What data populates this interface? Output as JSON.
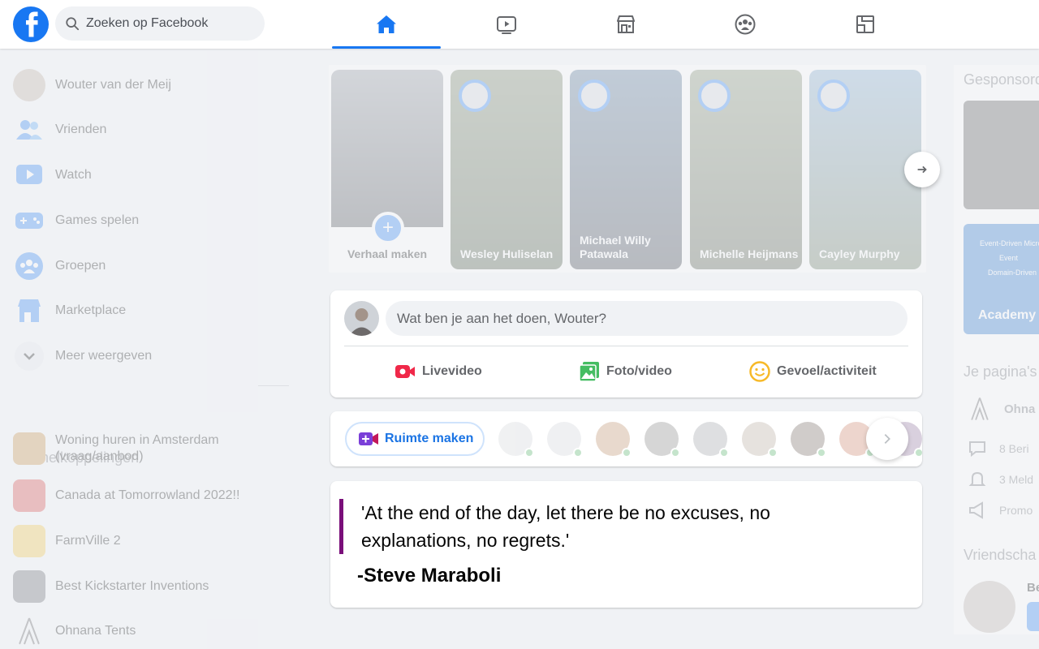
{
  "search": {
    "placeholder": "Zoeken op Facebook"
  },
  "nav": {
    "tabs": [
      {
        "name": "home-icon",
        "active": true
      },
      {
        "name": "watch-icon",
        "active": false
      },
      {
        "name": "marketplace-icon",
        "active": false
      },
      {
        "name": "groups-icon",
        "active": false
      },
      {
        "name": "gaming-icon",
        "active": false
      }
    ]
  },
  "sidebar": {
    "items": [
      {
        "label": "Wouter van der Meij",
        "icon": "avatar"
      },
      {
        "label": "Vrienden",
        "icon": "friends-icon"
      },
      {
        "label": "Watch",
        "icon": "watch-icon"
      },
      {
        "label": "Games spelen",
        "icon": "games-icon"
      },
      {
        "label": "Groepen",
        "icon": "groups-icon"
      },
      {
        "label": "Marketplace",
        "icon": "marketplace-icon"
      },
      {
        "label": "Meer weergeven",
        "icon": "chevron-down-icon"
      }
    ],
    "shortcuts_heading": "Je snelkoppelingen",
    "shortcuts": [
      {
        "label": "Woning huren in Amsterdam (vraag/aanbod)"
      },
      {
        "label": "Canada at Tomorrowland 2022!!"
      },
      {
        "label": "FarmVille 2"
      },
      {
        "label": "Best Kickstarter Inventions"
      },
      {
        "label": "Ohnana Tents"
      }
    ]
  },
  "stories": {
    "create_label": "Verhaal maken",
    "items": [
      {
        "name": "Wesley Huliselan"
      },
      {
        "name": "Michael Willy Patawala"
      },
      {
        "name": "Michelle Heijmans"
      },
      {
        "name": "Cayley Murphy"
      }
    ]
  },
  "composer": {
    "placeholder": "Wat ben je aan het doen, Wouter?",
    "live_label": "Livevideo",
    "photo_label": "Foto/video",
    "feeling_label": "Gevoel/activiteit"
  },
  "rooms": {
    "create_label": "Ruimte maken"
  },
  "quote": {
    "text": "'At the end of the day, let there be no excuses, no explanations, no regrets.'",
    "author": "-Steve Maraboli"
  },
  "right": {
    "sponsored_heading": "Gesponsord",
    "ad_title": "Academy",
    "ad_text_1": "Event-Driven Micro",
    "ad_text_2": "Event",
    "ad_text_3": "Domain-Driven",
    "pages_heading": "Je pagina's",
    "page_name": "Ohna",
    "page_messages": "8 Beri",
    "page_notifications": "3 Meld",
    "page_promote": "Promo",
    "friends_heading": "Vriendscha",
    "friend_name": "Be"
  },
  "colors": {
    "brand": "#1877f2",
    "quote_bar": "#7a0f7a",
    "online": "#31a24c"
  }
}
